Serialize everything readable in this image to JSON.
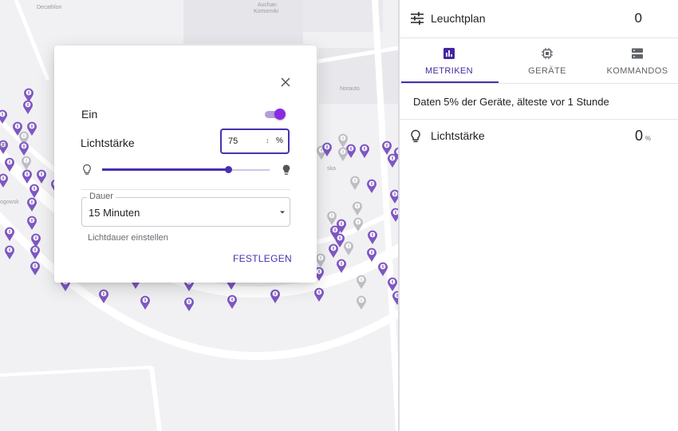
{
  "map": {
    "street_labels": [
      "Decathlon",
      "Auchan",
      "Komorniki",
      "Norauto",
      "ska",
      "ogowsk",
      "ga"
    ],
    "marker_color_active": "#7e57c2",
    "marker_color_inactive": "#bdbdc4"
  },
  "dialog": {
    "close_icon": "close-icon",
    "power_label": "Ein",
    "power_on": true,
    "brightness_label": "Lichtstärke",
    "brightness_value": "75",
    "brightness_spin": "↕",
    "brightness_unit": "%",
    "slider_value_percent": 75,
    "duration_legend": "Dauer",
    "duration_value": "15 Minuten",
    "duration_helper": "Lichtdauer einstellen",
    "submit_label": "FESTLEGEN",
    "accent_color": "#4a2fb0"
  },
  "panel": {
    "header_icon": "tune-icon",
    "title": "Leuchtplan",
    "count": "0",
    "tabs": [
      {
        "label": "METRIKEN",
        "icon": "chart-icon",
        "active": true
      },
      {
        "label": "GERÄTE",
        "icon": "chip-icon",
        "active": false
      },
      {
        "label": "KOMMANDOS",
        "icon": "server-icon",
        "active": false
      }
    ],
    "info_text": "Daten 5% der Geräte, älteste vor 1 Stunde",
    "metric": {
      "icon": "lightbulb-icon",
      "label": "Lichtstärke",
      "value": "0",
      "unit": "%"
    }
  }
}
